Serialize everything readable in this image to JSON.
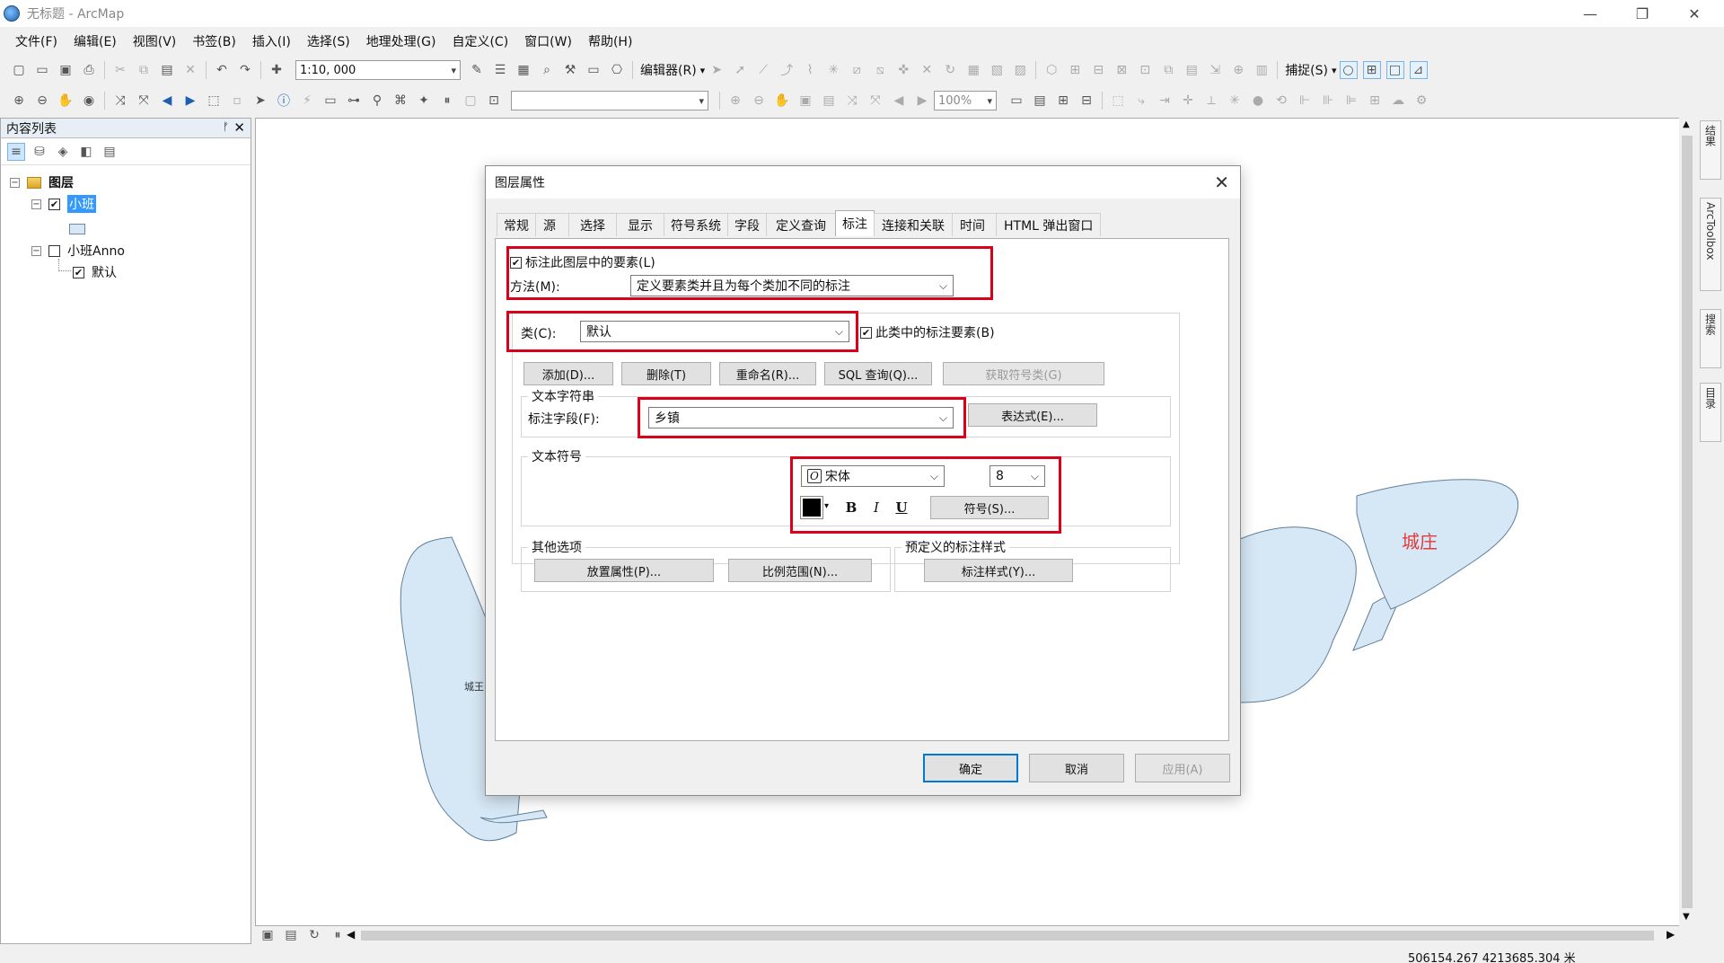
{
  "window": {
    "title": "无标题 - ArcMap",
    "minimize": "—",
    "restore": "❐",
    "close": "✕"
  },
  "menu": [
    "文件(F)",
    "编辑(E)",
    "视图(V)",
    "书签(B)",
    "插入(I)",
    "选择(S)",
    "地理处理(G)",
    "自定义(C)",
    "窗口(W)",
    "帮助(H)"
  ],
  "toolbar": {
    "scale": "1:10, 000",
    "editor": "编辑器(R)",
    "snapping": "捕捉(S)",
    "zoom": "100%"
  },
  "toc": {
    "title": "内容列表",
    "pin": "ᚠ",
    "close": "✕",
    "root": "图层",
    "layer1": "小班",
    "layer2": "小班Anno",
    "layer2_child": "默认"
  },
  "map": {
    "label_city": "城庄",
    "label_small": "城王"
  },
  "side_tabs": [
    "结果",
    "ArcToolbox",
    "搜索",
    "目录"
  ],
  "status": {
    "coords": "506154.267  4213685.304 米"
  },
  "dialog": {
    "title": "图层属性",
    "close": "✕",
    "tabs": [
      "常规",
      "源",
      "选择",
      "显示",
      "符号系统",
      "字段",
      "定义查询",
      "标注",
      "连接和关联",
      "时间",
      "HTML 弹出窗口"
    ],
    "label_features": "标注此图层中的要素(L)",
    "method_label": "方法(M):",
    "method_value": "定义要素类并且为每个类加不同的标注",
    "class_label": "类(C):",
    "class_value": "默认",
    "label_class_features": "此类中的标注要素(B)",
    "buttons": {
      "add": "添加(D)...",
      "delete": "删除(T)",
      "rename": "重命名(R)...",
      "sql": "SQL 查询(Q)...",
      "get_classes": "获取符号类(G)"
    },
    "text_string_group": "文本字符串",
    "label_field_label": "标注字段(F):",
    "label_field_value": "乡镇",
    "expression": "表达式(E)...",
    "text_symbol_group": "文本符号",
    "font": "宋体",
    "font_size": "8",
    "bold": "B",
    "italic": "I",
    "underline": "U",
    "symbol": "符号(S)...",
    "other_options": "其他选项",
    "placement": "放置属性(P)...",
    "scale_range": "比例范围(N)...",
    "predefined": "预定义的标注样式",
    "label_style": "标注样式(Y)...",
    "ok": "确定",
    "cancel": "取消",
    "apply": "应用(A)"
  },
  "colors": {
    "highlight_red": "#d9001b",
    "map_fill": "#d6e8f5",
    "city_label": "#e03a3a",
    "selection_blue": "#3399ff"
  }
}
